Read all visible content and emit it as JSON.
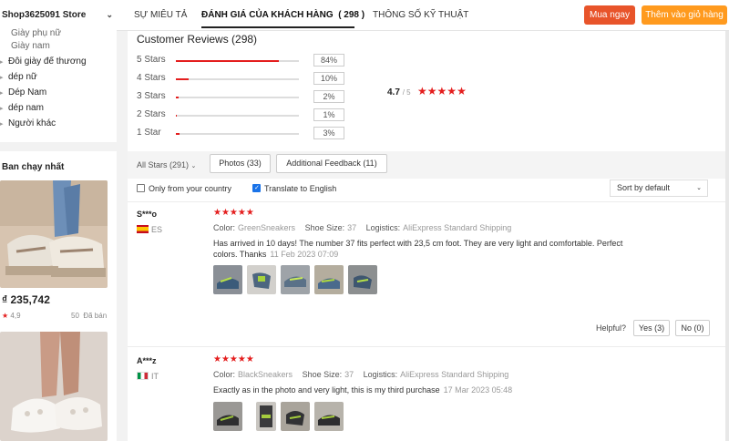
{
  "sidebar": {
    "store_name": "Shop3625091 Store",
    "categories": [
      {
        "label": "Giày phụ nữ",
        "sub": true
      },
      {
        "label": "Giày nam",
        "sub": true
      },
      {
        "label": "Đôi giày đế thương",
        "sub": false
      },
      {
        "label": "dép nữ",
        "sub": false
      },
      {
        "label": "Dép Nam",
        "sub": false
      },
      {
        "label": "dép nam",
        "sub": false
      },
      {
        "label": "Người khác",
        "sub": false
      }
    ],
    "bestsellers_title": "Ban chạy nhất",
    "product": {
      "price": "₫ 235,742",
      "rating": "4,9",
      "sold_count": "50",
      "sold_label": "Đã bán"
    }
  },
  "tabs": [
    {
      "label": "SỰ MIÊU TẢ",
      "active": false
    },
    {
      "label": "ĐÁNH GIÁ CỦA KHÁCH HÀNG",
      "count": "( 298 )",
      "active": true
    },
    {
      "label": "THÔNG SỐ KỸ THUẬT",
      "active": false
    }
  ],
  "actions": {
    "buy_now": "Mua ngay",
    "add_to_cart": "Thêm vào giỏ hàng",
    "buy_color": "#e8542a",
    "cart_color": "#ff9a1e"
  },
  "reviews_summary": {
    "title": "Customer Reviews (298)",
    "distribution": [
      {
        "label": "5 Stars",
        "pct": "84%",
        "value": 84
      },
      {
        "label": "4 Stars",
        "pct": "10%",
        "value": 10
      },
      {
        "label": "3 Stars",
        "pct": "2%",
        "value": 2
      },
      {
        "label": "2 Stars",
        "pct": "1%",
        "value": 1
      },
      {
        "label": "1 Star",
        "pct": "3%",
        "value": 3
      }
    ],
    "average": "4.7",
    "out_of": "/ 5",
    "star_color": "#e41e1e"
  },
  "filters": {
    "all_stars": "All Stars (291)",
    "photos": "Photos (33)",
    "additional_feedback": "Additional Feedback (11)",
    "only_country": "Only from your country",
    "only_country_checked": false,
    "translate": "Translate to English",
    "translate_checked": true,
    "sort": "Sort by default"
  },
  "reviews": [
    {
      "name": "S***o",
      "country": "ES",
      "stars": "★★★★★",
      "color_label": "Color:",
      "color": "GreenSneakers",
      "size_label": "Shoe Size:",
      "size": "37",
      "logistics_label": "Logistics:",
      "logistics": "AliExpress Standard Shipping",
      "text": "Has arrived in 10 days! The number 37 fits perfect with 23,5 cm foot. They are very light and comfortable. Perfect colors. Thanks",
      "date": "11 Feb 2023 07:09",
      "photo_count": 5
    },
    {
      "name": "A***z",
      "country": "IT",
      "stars": "★★★★★",
      "color_label": "Color:",
      "color": "BlackSneakers",
      "size_label": "Shoe Size:",
      "size": "37",
      "logistics_label": "Logistics:",
      "logistics": "AliExpress Standard Shipping",
      "text": "Exactly as in the photo and very light, this is my third purchase",
      "date": "17 Mar 2023 05:48",
      "photo_count": 4
    }
  ],
  "helpful": {
    "label": "Helpful?",
    "yes": "Yes (3)",
    "no": "No (0)"
  }
}
